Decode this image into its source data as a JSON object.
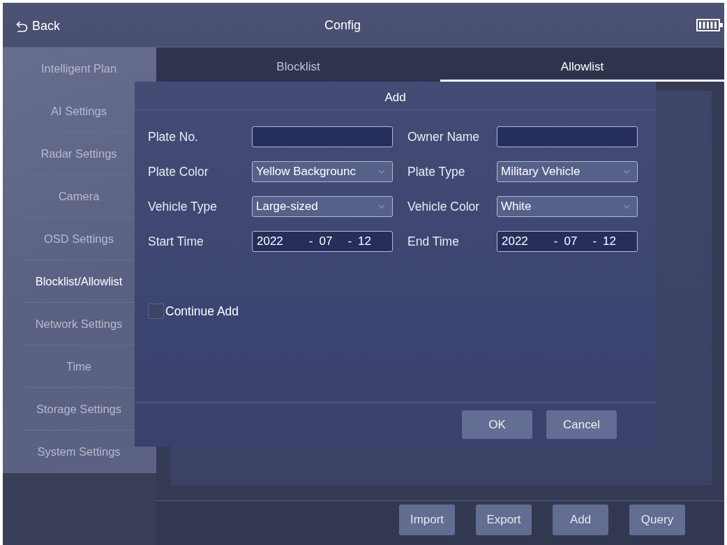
{
  "header": {
    "back_label": "Back",
    "title": "Config"
  },
  "sidebar": {
    "items": [
      {
        "label": "Intelligent Plan",
        "selected": false
      },
      {
        "label": "AI Settings",
        "selected": false
      },
      {
        "label": "Radar Settings",
        "selected": false
      },
      {
        "label": "Camera",
        "selected": false
      },
      {
        "label": "OSD Settings",
        "selected": false
      },
      {
        "label": "Blocklist/Allowlist",
        "selected": true
      },
      {
        "label": "Network Settings",
        "selected": false
      },
      {
        "label": "Time",
        "selected": false
      },
      {
        "label": "Storage Settings",
        "selected": false
      },
      {
        "label": "System Settings",
        "selected": false
      }
    ]
  },
  "tabs": [
    {
      "label": "Blocklist",
      "selected": false
    },
    {
      "label": "Allowlist",
      "selected": true
    }
  ],
  "dialog": {
    "title": "Add",
    "fields": [
      {
        "label": "Plate No.",
        "kind": "text"
      },
      {
        "label": "Owner Name",
        "kind": "text"
      },
      {
        "label": "Plate Color",
        "kind": "select",
        "value": "Yellow Backgrounc"
      },
      {
        "label": "Plate Type",
        "kind": "select",
        "value": "Military Vehicle"
      },
      {
        "label": "Vehicle Type",
        "kind": "select",
        "value": "Large-sized"
      },
      {
        "label": "Vehicle Color",
        "kind": "select",
        "value": "White"
      },
      {
        "label": "Start Time",
        "kind": "date",
        "year": "2022",
        "month": "07",
        "day": "12",
        "separators": [
          "-",
          "-"
        ]
      },
      {
        "label": "End Time",
        "kind": "date",
        "year": "2022",
        "month": "07",
        "day": "12",
        "separators": [
          "-",
          "-"
        ]
      }
    ],
    "continue_add": {
      "label": "Continue Add",
      "checked": false
    },
    "buttons": [
      "OK",
      "Cancel"
    ]
  },
  "toolbar": {
    "buttons": [
      "Import",
      "Export",
      "Add",
      "Query"
    ]
  }
}
